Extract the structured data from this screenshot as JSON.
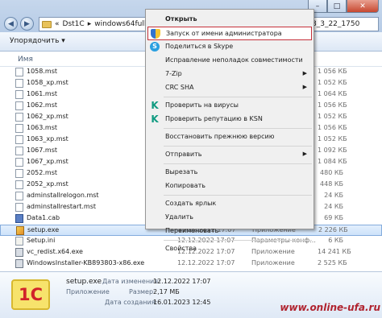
{
  "window": {
    "address_parts": [
      "Dst1C",
      "windows64full_8_3_"
    ],
    "address_right": "8_3_22_1750"
  },
  "toolbar": {
    "organize": "Упорядочить ▾"
  },
  "columns": {
    "name": "Имя"
  },
  "files": [
    {
      "name": "1058.mst",
      "date": "",
      "type": "",
      "size": "1 056 КБ",
      "icon": "file"
    },
    {
      "name": "1058_xp.mst",
      "date": "",
      "type": "",
      "size": "1 052 КБ",
      "icon": "file"
    },
    {
      "name": "1061.mst",
      "date": "",
      "type": "",
      "size": "1 064 КБ",
      "icon": "file"
    },
    {
      "name": "1062.mst",
      "date": "",
      "type": "",
      "size": "1 056 КБ",
      "icon": "file"
    },
    {
      "name": "1062_xp.mst",
      "date": "",
      "type": "",
      "size": "1 052 КБ",
      "icon": "file"
    },
    {
      "name": "1063.mst",
      "date": "",
      "type": "",
      "size": "1 056 КБ",
      "icon": "file"
    },
    {
      "name": "1063_xp.mst",
      "date": "",
      "type": "",
      "size": "1 052 КБ",
      "icon": "file"
    },
    {
      "name": "1067.mst",
      "date": "",
      "type": "",
      "size": "1 092 КБ",
      "icon": "file"
    },
    {
      "name": "1067_xp.mst",
      "date": "",
      "type": "",
      "size": "1 084 КБ",
      "icon": "file"
    },
    {
      "name": "2052.mst",
      "date": "",
      "type": "",
      "size": "480 КБ",
      "icon": "file"
    },
    {
      "name": "2052_xp.mst",
      "date": "",
      "type": "",
      "size": "448 КБ",
      "icon": "file"
    },
    {
      "name": "adminstallrelogon.mst",
      "date": "",
      "type": "",
      "size": "24 КБ",
      "icon": "file"
    },
    {
      "name": "adminstallrestart.mst",
      "date": "",
      "type": "",
      "size": "24 КБ",
      "icon": "file"
    },
    {
      "name": "Data1.cab",
      "date": "",
      "type": "",
      "size": "69 КБ",
      "icon": "cab"
    },
    {
      "name": "setup.exe",
      "date": "12.12.2022 17:07",
      "type": "Приложение",
      "size": "2 226 КБ",
      "icon": "setup"
    },
    {
      "name": "Setup.ini",
      "date": "12.12.2022 17:07",
      "type": "Параметры конф...",
      "size": "6 КБ",
      "icon": "ini"
    },
    {
      "name": "vc_redist.x64.exe",
      "date": "12.12.2022 17:07",
      "type": "Приложение",
      "size": "14 241 КБ",
      "icon": "exe"
    },
    {
      "name": "WindowsInstaller-KB893803-x86.exe",
      "date": "12.12.2022 17:07",
      "type": "Приложение",
      "size": "2 525 КБ",
      "icon": "exe"
    }
  ],
  "menu": [
    {
      "label": "Открыть",
      "bold": true,
      "icon": ""
    },
    {
      "label": "Запуск от имени администратора",
      "highlight": true,
      "icon": "shield"
    },
    {
      "label": "Поделиться в Skype",
      "icon": "skype"
    },
    {
      "label": "Исправление неполадок совместимости",
      "icon": ""
    },
    {
      "label": "7-Zip",
      "arrow": true,
      "icon": ""
    },
    {
      "label": "CRC SHA",
      "arrow": true,
      "icon": ""
    },
    {
      "sep": true
    },
    {
      "label": "Проверить на вирусы",
      "icon": "kas"
    },
    {
      "label": "Проверить репутацию в KSN",
      "icon": "kas"
    },
    {
      "sep": true
    },
    {
      "label": "Восстановить прежнюю версию",
      "icon": ""
    },
    {
      "sep": true
    },
    {
      "label": "Отправить",
      "arrow": true,
      "icon": ""
    },
    {
      "sep": true
    },
    {
      "label": "Вырезать",
      "icon": ""
    },
    {
      "label": "Копировать",
      "icon": ""
    },
    {
      "sep": true
    },
    {
      "label": "Создать ярлык",
      "icon": ""
    },
    {
      "label": "Удалить",
      "icon": ""
    },
    {
      "label": "Переименовать",
      "icon": ""
    },
    {
      "sep": true
    },
    {
      "label": "Свойства",
      "icon": ""
    }
  ],
  "details": {
    "name": "setup.exe",
    "type": "Приложение",
    "modified_label": "Дата изменения:",
    "modified": "12.12.2022 17:07",
    "size_label": "Размер:",
    "size": "2,17 МБ",
    "created_label": "Дата создания:",
    "created": "16.01.2023 12:45",
    "logo": "1С"
  },
  "watermark": "www.online-ufa.ru"
}
